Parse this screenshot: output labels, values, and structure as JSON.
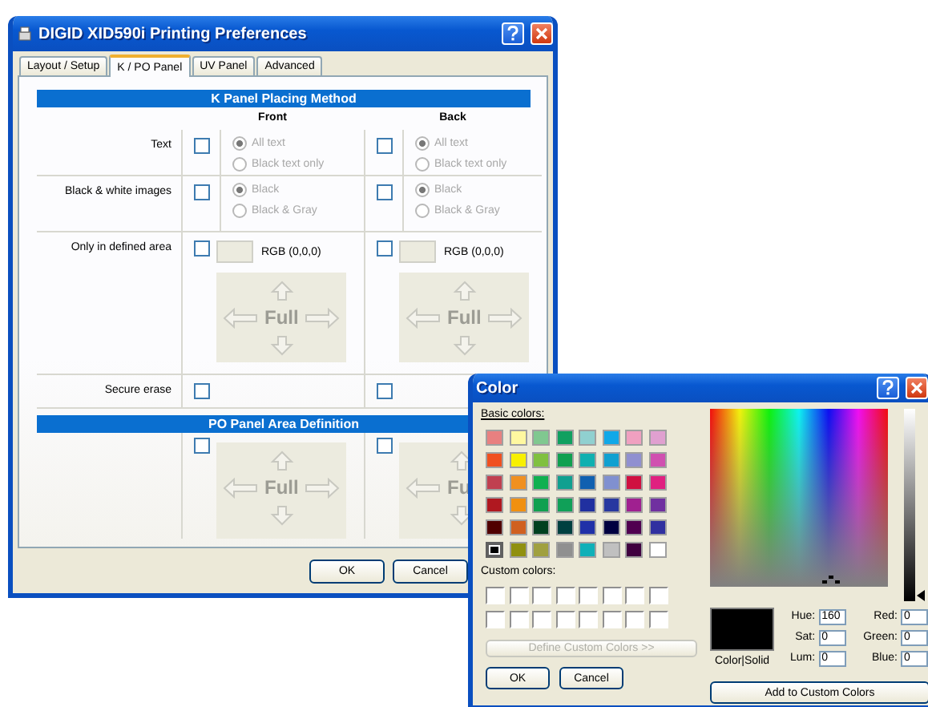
{
  "prefs_window": {
    "title": "DIGID XID590i Printing Preferences",
    "tabs": [
      {
        "label": "Layout / Setup",
        "selected": false
      },
      {
        "label": "K / PO Panel",
        "selected": true
      },
      {
        "label": "UV Panel",
        "selected": false
      },
      {
        "label": "Advanced",
        "selected": false
      }
    ],
    "sections": [
      {
        "heading": "K Panel Placing Method",
        "columns": [
          "Front",
          "Back"
        ],
        "rows": [
          {
            "kind": "radio",
            "label": "Text",
            "cells": [
              {
                "checked": false,
                "options": [
                  {
                    "label": "All text",
                    "selected": true,
                    "disabled": true
                  },
                  {
                    "label": "Black text only",
                    "selected": false,
                    "disabled": true
                  }
                ]
              },
              {
                "checked": false,
                "options": [
                  {
                    "label": "All text",
                    "selected": true,
                    "disabled": true
                  },
                  {
                    "label": "Black text only",
                    "selected": false,
                    "disabled": true
                  }
                ]
              }
            ]
          },
          {
            "kind": "radio",
            "label": "Black & white images",
            "cells": [
              {
                "checked": false,
                "options": [
                  {
                    "label": "Black",
                    "selected": true,
                    "disabled": true
                  },
                  {
                    "label": "Black & Gray",
                    "selected": false,
                    "disabled": true
                  }
                ]
              },
              {
                "checked": false,
                "options": [
                  {
                    "label": "Black",
                    "selected": true,
                    "disabled": true
                  },
                  {
                    "label": "Black & Gray",
                    "selected": false,
                    "disabled": true
                  }
                ]
              }
            ]
          },
          {
            "kind": "area",
            "label": "Only in defined area",
            "cells": [
              {
                "checked": false,
                "reading": "RGB (0,0,0)",
                "pad": {
                  "label": "Full",
                  "clipped": false
                }
              },
              {
                "checked": false,
                "reading": "RGB (0,0,0)",
                "pad": {
                  "label": "Full",
                  "clipped": false
                }
              }
            ]
          },
          {
            "kind": "check",
            "label": "Secure erase",
            "cells": [
              {
                "checked": false
              },
              {
                "checked": false
              }
            ]
          }
        ]
      },
      {
        "heading": "PO Panel Area Definition",
        "rows": [
          {
            "kind": "pad",
            "cells": [
              {
                "checked": false,
                "pad": {
                  "label": "Full",
                  "clipped": false
                }
              },
              {
                "checked": false,
                "pad": {
                  "label": "Fu",
                  "clipped": true
                }
              }
            ]
          }
        ]
      }
    ],
    "buttons": [
      "OK",
      "Cancel"
    ]
  },
  "color_dialog": {
    "title": "Color",
    "basic_label": "Basic colors:",
    "basic_colors": [
      {
        "color": "#e88080",
        "selected": false
      },
      {
        "color": "#fff8a0",
        "selected": false
      },
      {
        "color": "#80c890",
        "selected": false
      },
      {
        "color": "#10a060",
        "selected": false
      },
      {
        "color": "#90d0d0",
        "selected": false
      },
      {
        "color": "#10a8e8",
        "selected": false
      },
      {
        "color": "#f0a0c0",
        "selected": false
      },
      {
        "color": "#e0a0d0",
        "selected": false
      },
      {
        "color": "#f05020",
        "selected": false
      },
      {
        "color": "#f8f000",
        "selected": false
      },
      {
        "color": "#80c040",
        "selected": false
      },
      {
        "color": "#10a050",
        "selected": false
      },
      {
        "color": "#10b0b0",
        "selected": false
      },
      {
        "color": "#10a0d0",
        "selected": false
      },
      {
        "color": "#9090d0",
        "selected": false
      },
      {
        "color": "#d050b0",
        "selected": false
      },
      {
        "color": "#c04050",
        "selected": false
      },
      {
        "color": "#f09020",
        "selected": false
      },
      {
        "color": "#10b050",
        "selected": false
      },
      {
        "color": "#10a090",
        "selected": false
      },
      {
        "color": "#1060b0",
        "selected": false
      },
      {
        "color": "#8090d0",
        "selected": false
      },
      {
        "color": "#d01040",
        "selected": false
      },
      {
        "color": "#e02080",
        "selected": false
      },
      {
        "color": "#b01820",
        "selected": false
      },
      {
        "color": "#f09010",
        "selected": false
      },
      {
        "color": "#10a050",
        "selected": false
      },
      {
        "color": "#10a058",
        "selected": false
      },
      {
        "color": "#2030a0",
        "selected": false
      },
      {
        "color": "#2838a0",
        "selected": false
      },
      {
        "color": "#a02090",
        "selected": false
      },
      {
        "color": "#7030a0",
        "selected": false
      },
      {
        "color": "#500000",
        "selected": false
      },
      {
        "color": "#d06020",
        "selected": false
      },
      {
        "color": "#004020",
        "selected": false
      },
      {
        "color": "#004040",
        "selected": false
      },
      {
        "color": "#2030a8",
        "selected": false
      },
      {
        "color": "#000040",
        "selected": false
      },
      {
        "color": "#500050",
        "selected": false
      },
      {
        "color": "#3030a0",
        "selected": false
      },
      {
        "color": "#000000",
        "selected": true
      },
      {
        "color": "#909010",
        "selected": false
      },
      {
        "color": "#a0a040",
        "selected": false
      },
      {
        "color": "#909090",
        "selected": false
      },
      {
        "color": "#10b0b8",
        "selected": false
      },
      {
        "color": "#c0c0c0",
        "selected": false
      },
      {
        "color": "#400040",
        "selected": false
      },
      {
        "color": "#ffffff",
        "selected": false
      }
    ],
    "custom_label": "Custom colors:",
    "custom_colors": [
      {
        "color": "#ffffff"
      },
      {
        "color": "#ffffff"
      },
      {
        "color": "#ffffff"
      },
      {
        "color": "#ffffff"
      },
      {
        "color": "#ffffff"
      },
      {
        "color": "#ffffff"
      },
      {
        "color": "#ffffff"
      },
      {
        "color": "#ffffff"
      },
      {
        "color": "#ffffff"
      },
      {
        "color": "#ffffff"
      },
      {
        "color": "#ffffff"
      },
      {
        "color": "#ffffff"
      },
      {
        "color": "#ffffff"
      },
      {
        "color": "#ffffff"
      },
      {
        "color": "#ffffff"
      },
      {
        "color": "#ffffff"
      }
    ],
    "define_button": {
      "label": "Define Custom Colors >>",
      "disabled": true
    },
    "preview_label": "Color|Solid",
    "fields": [
      {
        "label": "Hue:",
        "value": "160"
      },
      {
        "label": "Sat:",
        "value": "0"
      },
      {
        "label": "Lum:",
        "value": "0"
      },
      {
        "label": "Red:",
        "value": "0"
      },
      {
        "label": "Green:",
        "value": "0"
      },
      {
        "label": "Blue:",
        "value": "0"
      }
    ],
    "buttons": [
      "OK",
      "Cancel"
    ],
    "add_button": "Add to Custom Colors"
  }
}
